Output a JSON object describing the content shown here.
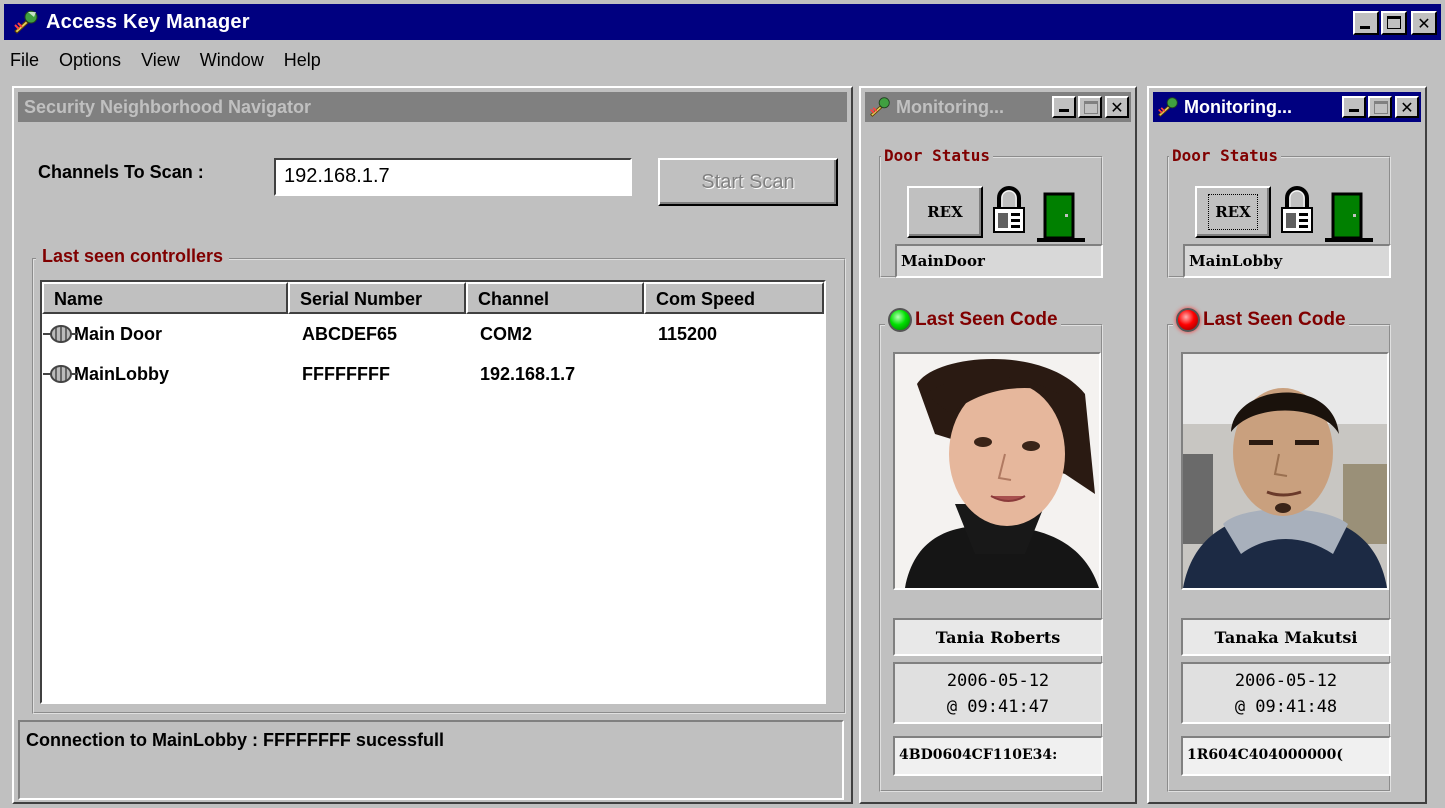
{
  "app": {
    "title": "Access Key Manager",
    "window_controls": [
      "minimize",
      "maximize",
      "close"
    ]
  },
  "menu": [
    "File",
    "Options",
    "View",
    "Window",
    "Help"
  ],
  "navigator": {
    "title": "Security Neighborhood Navigator",
    "channels_label": "Channels To Scan :",
    "channels_value": "192.168.1.7",
    "start_scan_label": "Start Scan",
    "controllers_group_label": "Last seen controllers",
    "columns": [
      "Name",
      "Serial Number",
      "Channel",
      "Com Speed"
    ],
    "rows": [
      {
        "name": "Main Door",
        "serial": "ABCDEF65",
        "channel": "COM2",
        "speed": "115200"
      },
      {
        "name": "MainLobby",
        "serial": "FFFFFFFF",
        "channel": "192.168.1.7",
        "speed": ""
      }
    ],
    "status": "Connection to MainLobby : FFFFFFFF sucessfull"
  },
  "monitors": [
    {
      "title": "Monitoring...",
      "active": false,
      "door_status_label": "Door Status",
      "rex_label": "REX",
      "door_name": "MainDoor",
      "last_seen_label": "Last Seen Code",
      "led_color": "#00e000",
      "person_name": "Tania Roberts",
      "date": "2006-05-12",
      "time": "@ 09:41:47",
      "code": "4BD0604CF110E34:"
    },
    {
      "title": "Monitoring...",
      "active": true,
      "door_status_label": "Door Status",
      "rex_label": "REX",
      "door_name": "MainLobby",
      "last_seen_label": "Last Seen Code",
      "led_color": "#ff0000",
      "person_name": "Tanaka Makutsi",
      "date": "2006-05-12",
      "time": "@ 09:41:48",
      "code": "1R604C404000000("
    }
  ],
  "colors": {
    "title_active": "#000080",
    "title_inactive": "#808080",
    "legend_text": "#800000",
    "door_green": "#008000"
  }
}
